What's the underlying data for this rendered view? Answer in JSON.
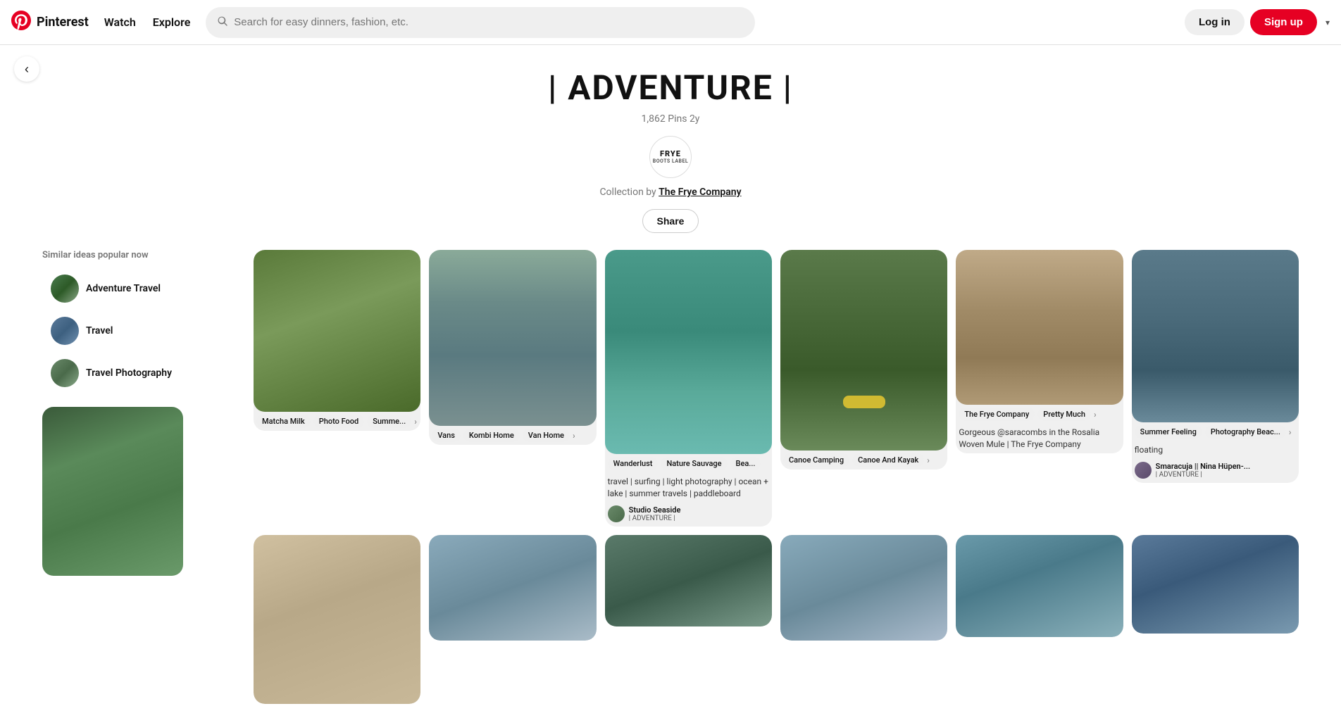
{
  "header": {
    "logo_text": "Pinterest",
    "nav_watch": "Watch",
    "nav_explore": "Explore",
    "search_placeholder": "Search for easy dinners, fashion, etc.",
    "login_label": "Log in",
    "signup_label": "Sign up"
  },
  "board": {
    "title": "| ADVENTURE |",
    "pins_count": "1,862 Pins",
    "age": "2y",
    "logo_text": "FRYE\nBOOTS LABEL",
    "collection_prefix": "Collection by ",
    "collection_owner": "The Frye Company",
    "share_label": "Share"
  },
  "sidebar": {
    "similar_title": "Similar ideas popular now",
    "items": [
      {
        "label": "Adventure Travel"
      },
      {
        "label": "Travel"
      },
      {
        "label": "Travel Photography"
      }
    ]
  },
  "pins": [
    {
      "tags": [
        "Matcha Milk",
        "Photo Food",
        "Summe..."
      ],
      "col_span": 1
    },
    {
      "tags": [
        "Vans",
        "Kombi Home",
        "Van Home"
      ],
      "col_span": 1
    },
    {
      "tags": [
        "Wanderlust",
        "Nature Sauvage",
        "Bea..."
      ],
      "desc": "travel | surfing | light photography | ocean + lake | summer travels | paddleboard",
      "user": "Studio Seaside",
      "board": "| ADVENTURE |",
      "col_span": 1
    },
    {
      "tags": [
        "Canoe Camping",
        "Canoe And Kayak"
      ],
      "col_span": 1
    },
    {
      "tags": [
        "The Frye Company",
        "Pretty Much"
      ],
      "desc": "Gorgeous @saracombs in the Rosalia Woven Mule | The Frye Company",
      "col_span": 1
    },
    {
      "tags": [
        "Summer Feeling",
        "Photography Beac..."
      ],
      "desc": "floating",
      "user": "Smaracuja || Nina Hüpen-...",
      "board": "| ADVENTURE |",
      "col_span": 1
    }
  ]
}
